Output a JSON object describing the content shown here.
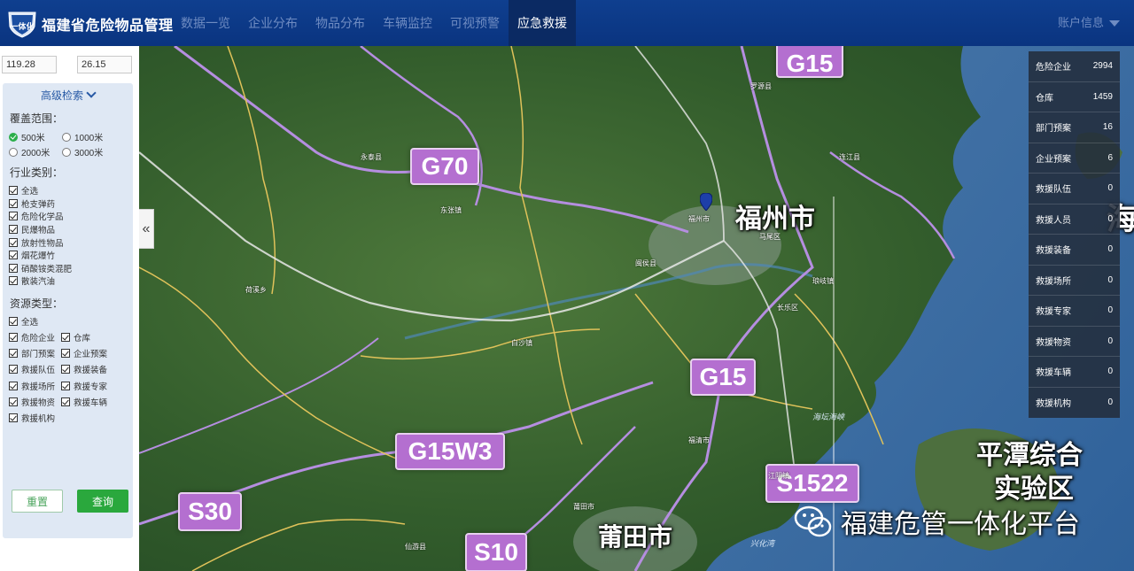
{
  "header": {
    "logo_text": "一体化",
    "title": "福建省危险物品管理",
    "nav": [
      "数据一览",
      "企业分布",
      "物品分布",
      "车辆监控",
      "可视预警",
      "应急救援"
    ],
    "active_nav": "应急救援",
    "account": "账户信息"
  },
  "left_panel": {
    "longitude": "119.28",
    "latitude": "26.15",
    "advanced_search": "高级检索",
    "coverage": {
      "title": "覆盖范围：",
      "options": [
        "500米",
        "1000米",
        "2000米",
        "3000米"
      ],
      "selected": "500米"
    },
    "industry": {
      "title": "行业类别：",
      "items": [
        "全选",
        "枪支弹药",
        "危险化学品",
        "民爆物品",
        "放射性物品",
        "烟花爆竹",
        "硝酸铵类混肥",
        "散装汽油"
      ]
    },
    "resource": {
      "title": "资源类型：",
      "select_all": "全选",
      "items": [
        "危险企业",
        "仓库",
        "部门预案",
        "企业预案",
        "救援队伍",
        "救援装备",
        "救援场所",
        "救援专家",
        "救援物资",
        "救援车辆",
        "救援机构"
      ]
    },
    "reset_label": "重置",
    "query_label": "查询"
  },
  "map": {
    "shields": {
      "g70": "G70",
      "g15_top": "G15",
      "g15_mid": "G15",
      "g15w3": "G15W3",
      "s30": "S30",
      "s10": "S10",
      "s1522": "S1522"
    },
    "cities": {
      "fuzhou": "福州市",
      "putian": "莆田市",
      "pingtan": "平潭综合实验区",
      "pingtan_l1": "平潭综合",
      "pingtan_l2": "实验区",
      "hai": "海"
    },
    "towns": [
      "福州市",
      "罗源县",
      "连江县",
      "闽侯县",
      "长乐区",
      "永泰县",
      "福清市",
      "莆田市",
      "仙游县",
      "东张镇",
      "荷溪乡",
      "白沙镇",
      "马尾区",
      "琅岐镇",
      "江阴镇"
    ],
    "seas": [
      "兴化湾",
      "海坛海峡"
    ],
    "watermark": "福建危管一体化平台"
  },
  "stats": [
    {
      "label": "危险企业",
      "value": "2994"
    },
    {
      "label": "仓库",
      "value": "1459"
    },
    {
      "label": "部门预案",
      "value": "16"
    },
    {
      "label": "企业预案",
      "value": "6"
    },
    {
      "label": "救援队伍",
      "value": "0"
    },
    {
      "label": "救援人员",
      "value": "0"
    },
    {
      "label": "救援装备",
      "value": "0"
    },
    {
      "label": "救援场所",
      "value": "0"
    },
    {
      "label": "救援专家",
      "value": "0"
    },
    {
      "label": "救援物资",
      "value": "0"
    },
    {
      "label": "救援车辆",
      "value": "0"
    },
    {
      "label": "救援机构",
      "value": "0"
    }
  ],
  "colors": {
    "nav_bg": "#0f3f8f",
    "nav_active_bg": "#0b2a63",
    "query_button": "#2aa83d",
    "shield": "#b46fd0",
    "stats_bg": "#232d3c"
  }
}
